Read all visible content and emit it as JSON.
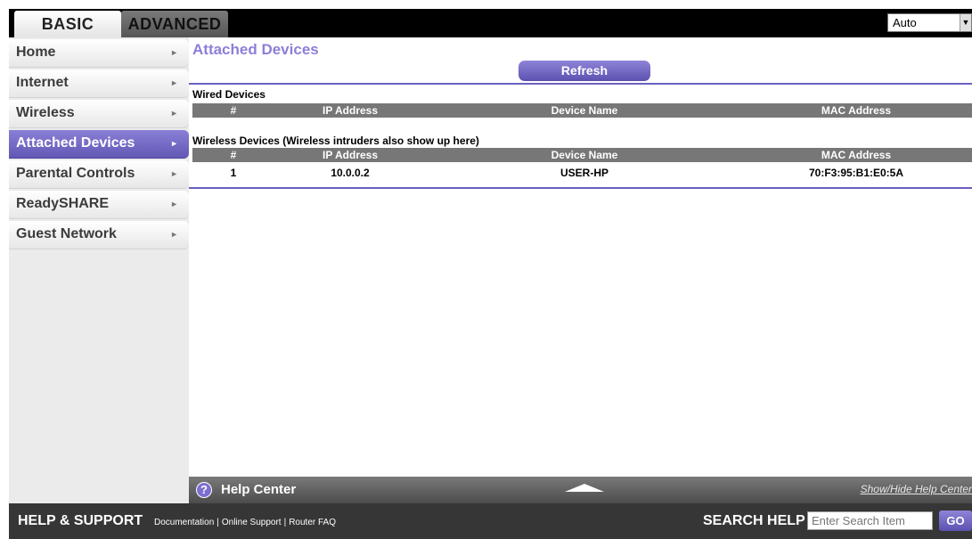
{
  "tabs": {
    "basic": "BASIC",
    "advanced": "ADVANCED"
  },
  "language": {
    "selected": "Auto",
    "arrow_icon": "chevron-down-icon"
  },
  "sidebar": {
    "items": [
      {
        "label": "Home",
        "active": false
      },
      {
        "label": "Internet",
        "active": false
      },
      {
        "label": "Wireless",
        "active": false
      },
      {
        "label": "Attached Devices",
        "active": true
      },
      {
        "label": "Parental Controls",
        "active": false
      },
      {
        "label": "ReadySHARE",
        "active": false
      },
      {
        "label": "Guest Network",
        "active": false
      }
    ],
    "arrow_icon": "chevron-right-icon"
  },
  "main": {
    "title": "Attached Devices",
    "refresh_label": "Refresh",
    "wired": {
      "title": "Wired Devices",
      "columns": [
        "#",
        "IP Address",
        "Device Name",
        "MAC Address"
      ],
      "rows": []
    },
    "wireless": {
      "title": "Wireless Devices (Wireless intruders also show up here)",
      "columns": [
        "#",
        "IP Address",
        "Device Name",
        "MAC Address"
      ],
      "rows": [
        {
          "num": "1",
          "ip": "10.0.0.2",
          "name": "USER-HP",
          "mac": "70:F3:95:B1:E0:5A"
        }
      ]
    }
  },
  "help_center": {
    "icon": "question-icon",
    "title": "Help Center",
    "toggle_icon": "triangle-up-icon",
    "show_hide": "Show/Hide Help Center"
  },
  "footer": {
    "title": "HELP & SUPPORT",
    "links": [
      "Documentation",
      "Online Support",
      "Router FAQ"
    ],
    "search_label": "SEARCH HELP",
    "search_placeholder": "Enter Search Item",
    "go_label": "GO"
  },
  "colors": {
    "accent": "#6b61c2",
    "title": "#8c7fd9",
    "table_header": "#777777",
    "footer": "#363636"
  }
}
